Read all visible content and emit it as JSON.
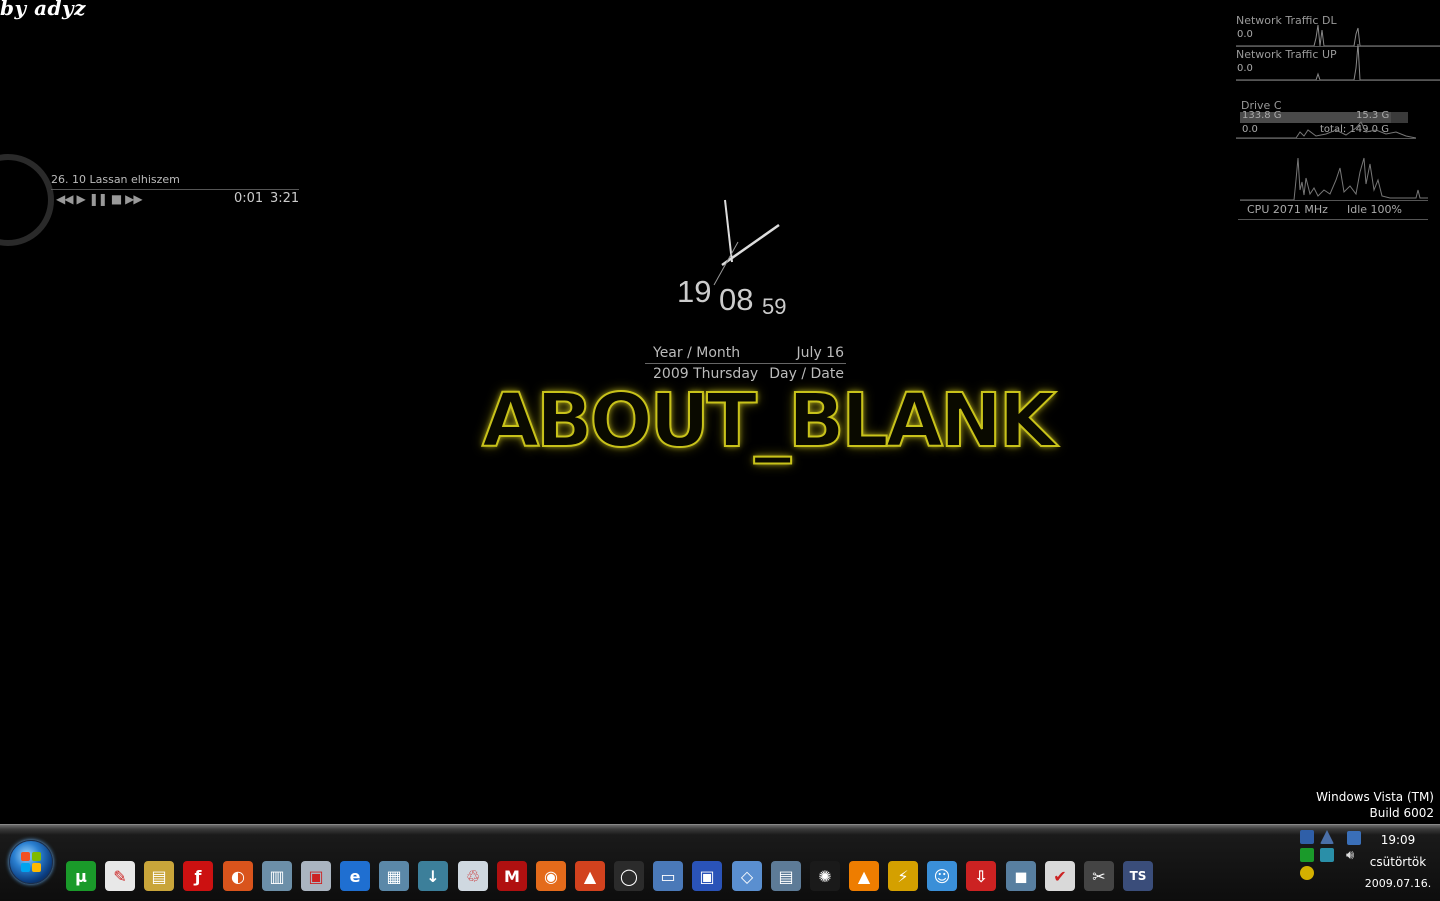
{
  "signature": "by adyz",
  "player": {
    "track": "26. 10 Lassan elhiszem",
    "elapsed": "0:01",
    "duration": "3:21",
    "controls": [
      "prev-icon",
      "play-icon",
      "pause-icon",
      "stop-icon",
      "next-icon"
    ]
  },
  "clock": {
    "hours": "19",
    "minutes": "08",
    "seconds": "59"
  },
  "date": {
    "label_year_month": "Year / Month",
    "value_month_day": "July 16",
    "value_year_weekday": "2009 Thursday",
    "label_day_date": "Day / Date"
  },
  "logo_text": "ABOUT_BLANK",
  "monitor": {
    "net_dl_label": "Network Traffic DL",
    "net_dl_value": "0.0",
    "net_up_label": "Network Traffic UP",
    "net_up_value": "0.0",
    "drive_label": "Drive C",
    "drive_used": "133.8 G",
    "drive_free": "15.3 G",
    "drive_zero": "0.0",
    "drive_total": "total: 149.0 G",
    "cpu_freq": "CPU 2071 MHz",
    "cpu_idle": "Idle 100%"
  },
  "watermark": {
    "line1": "Windows Vista (TM)",
    "line2": "Build 6002"
  },
  "taskbar": {
    "quick_launch": [
      {
        "name": "utorrent-icon",
        "bg": "#1a9a2a",
        "glyph": "µ"
      },
      {
        "name": "feather-icon",
        "bg": "#e8e8e8",
        "glyph": "✎"
      },
      {
        "name": "winrar-icon",
        "bg": "#c9a53a",
        "glyph": "▤"
      },
      {
        "name": "flash-icon",
        "bg": "#cc1111",
        "glyph": "ƒ"
      },
      {
        "name": "browser-ball-icon",
        "bg": "#d9541c",
        "glyph": "◐"
      },
      {
        "name": "documents-icon",
        "bg": "#6c8fa8",
        "glyph": "▥"
      },
      {
        "name": "scanner-icon",
        "bg": "#aab4c0",
        "glyph": "▣"
      },
      {
        "name": "internet-explorer-icon",
        "bg": "#1f6fd1",
        "glyph": "e"
      },
      {
        "name": "media-library-icon",
        "bg": "#5b88a8",
        "glyph": "▦"
      },
      {
        "name": "downloads-icon",
        "bg": "#3c7f9a",
        "glyph": "↓"
      },
      {
        "name": "recycle-bin-icon",
        "bg": "#cfd8e0",
        "glyph": "♲"
      },
      {
        "name": "mafia-game-icon",
        "bg": "#b01010",
        "glyph": "M"
      },
      {
        "name": "firefox-icon",
        "bg": "#e46b1b",
        "glyph": "◉"
      },
      {
        "name": "burning-app-icon",
        "bg": "#d2421e",
        "glyph": "▲"
      },
      {
        "name": "red-ring-icon",
        "bg": "#2b2b2b",
        "glyph": "◯"
      },
      {
        "name": "computer-icon",
        "bg": "#4a79b8",
        "glyph": "▭"
      },
      {
        "name": "floppy-save-icon",
        "bg": "#2a53b8",
        "glyph": "▣"
      },
      {
        "name": "network-icon",
        "bg": "#5a8fd0",
        "glyph": "◇"
      },
      {
        "name": "folder-icon",
        "bg": "#5d7b97",
        "glyph": "▤"
      },
      {
        "name": "red-swirl-icon",
        "bg": "#1a1a1a",
        "glyph": "✺"
      },
      {
        "name": "vlc-icon",
        "bg": "#ee7d00",
        "glyph": "▲"
      },
      {
        "name": "winamp-icon",
        "bg": "#d4a000",
        "glyph": "⚡"
      },
      {
        "name": "messenger-icon",
        "bg": "#3a8fd8",
        "glyph": "☺"
      },
      {
        "name": "download-manager-icon",
        "bg": "#cc2222",
        "glyph": "⇩"
      },
      {
        "name": "disk-tool-icon",
        "bg": "#587fa0",
        "glyph": "◼"
      },
      {
        "name": "checkmark-icon",
        "bg": "#d9d9d9",
        "glyph": "✔"
      },
      {
        "name": "scissors-icon",
        "bg": "#444",
        "glyph": "✂"
      },
      {
        "name": "teamspeak-icon",
        "bg": "#3a4d7a",
        "glyph": "TS"
      }
    ],
    "tray": {
      "time": "19:09",
      "weekday": "csütörtök",
      "date": "2009.07.16."
    }
  }
}
